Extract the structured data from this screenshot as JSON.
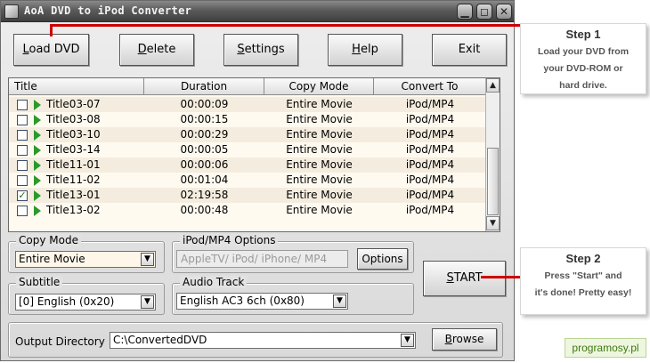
{
  "window": {
    "title": "AoA DVD to iPod Converter",
    "min_symbol": "▁",
    "max_symbol": "◻",
    "close_symbol": "✕"
  },
  "toolbar": {
    "load_dvd": {
      "pre": "",
      "key": "L",
      "post": "oad DVD"
    },
    "delete": {
      "pre": "",
      "key": "D",
      "post": "elete"
    },
    "settings": {
      "pre": "",
      "key": "S",
      "post": "ettings"
    },
    "help": {
      "pre": "",
      "key": "H",
      "post": "elp"
    },
    "exit": "Exit"
  },
  "list": {
    "headers": {
      "title": "Title",
      "duration": "Duration",
      "copy_mode": "Copy Mode",
      "convert_to": "Convert To"
    },
    "rows": [
      {
        "title": "Title03-07",
        "duration": "00:00:09",
        "copy_mode": "Entire Movie",
        "convert_to": "iPod/MP4",
        "check": ""
      },
      {
        "title": "Title03-08",
        "duration": "00:00:15",
        "copy_mode": "Entire Movie",
        "convert_to": "iPod/MP4",
        "check": ""
      },
      {
        "title": "Title03-10",
        "duration": "00:00:29",
        "copy_mode": "Entire Movie",
        "convert_to": "iPod/MP4",
        "check": ""
      },
      {
        "title": "Title03-14",
        "duration": "00:00:05",
        "copy_mode": "Entire Movie",
        "convert_to": "iPod/MP4",
        "check": ""
      },
      {
        "title": "Title11-01",
        "duration": "00:00:06",
        "copy_mode": "Entire Movie",
        "convert_to": "iPod/MP4",
        "check": ""
      },
      {
        "title": "Title11-02",
        "duration": "00:01:04",
        "copy_mode": "Entire Movie",
        "convert_to": "iPod/MP4",
        "check": ""
      },
      {
        "title": "Title13-01",
        "duration": "02:19:58",
        "copy_mode": "Entire Movie",
        "convert_to": "iPod/MP4",
        "check": "✓"
      },
      {
        "title": "Title13-02",
        "duration": "00:00:48",
        "copy_mode": "Entire Movie",
        "convert_to": "iPod/MP4",
        "check": ""
      }
    ],
    "scroll_up": "▲",
    "scroll_down": "▼"
  },
  "copy_mode": {
    "label": "Copy Mode",
    "value": "Entire Movie"
  },
  "ipod_options": {
    "label": "iPod/MP4 Options",
    "field": "AppleTV/ iPod/ iPhone/ MP4",
    "button": "Options"
  },
  "subtitle": {
    "label": "Subtitle",
    "value": "[0] English (0x20)"
  },
  "audio_track": {
    "label": "Audio Track",
    "value": "English AC3 6ch (0x80)"
  },
  "start": {
    "pre": "",
    "key": "S",
    "post": "TART"
  },
  "output": {
    "label": "Output Directory",
    "value": "C:\\ConvertedDVD",
    "browse": {
      "pre": "",
      "key": "B",
      "post": "rowse"
    }
  },
  "dropdown_arrow": "▼",
  "callouts": {
    "step1": {
      "title": "Step 1",
      "lines": [
        "Load your DVD from",
        "your DVD-ROM or",
        "hard drive."
      ]
    },
    "step2": {
      "title": "Step 2",
      "lines": [
        "Press \"Start\" and",
        "it's done! Pretty easy!"
      ]
    }
  },
  "watermark": "programosy.pl",
  "colors": {
    "accent_red": "#cc0000",
    "play_green": "#2a9a2a",
    "row_alt": "#f4eddf",
    "list_bg": "#fffaf0"
  }
}
